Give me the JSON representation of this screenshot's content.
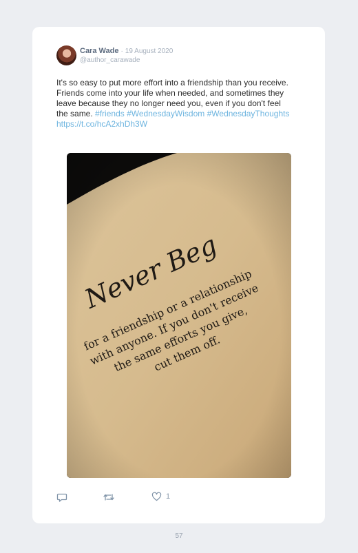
{
  "post": {
    "author_name": "Cara Wade",
    "separator": "·",
    "date": "19 August 2020",
    "handle": "@author_carawade",
    "text": "It's so easy to put more effort into a friendship than you receive. Friends come into your life when needed, and sometimes they leave because they no longer need you, even if you don't feel the same.",
    "hashtags": [
      "#friends",
      "#WednesdayWisdom",
      "#WednesdayThoughts"
    ],
    "link": "https://t.co/hcA2xhDh3W",
    "like_count": "1"
  },
  "image_text": {
    "title": "Never Beg",
    "lines": [
      "for a friendship or a relationship",
      "with anyone. If you don't receive",
      "the same efforts you give,",
      "cut them off."
    ]
  },
  "icons": {
    "reply": "reply-icon",
    "retweet": "retweet-icon",
    "like": "heart-icon"
  },
  "footer": {
    "page_number": "57"
  },
  "colors": {
    "background": "#eceef2",
    "card": "#ffffff",
    "link": "#6db4df",
    "author": "#5c6b7f",
    "muted": "#a6b0bd",
    "paper": "#d7bf94"
  }
}
